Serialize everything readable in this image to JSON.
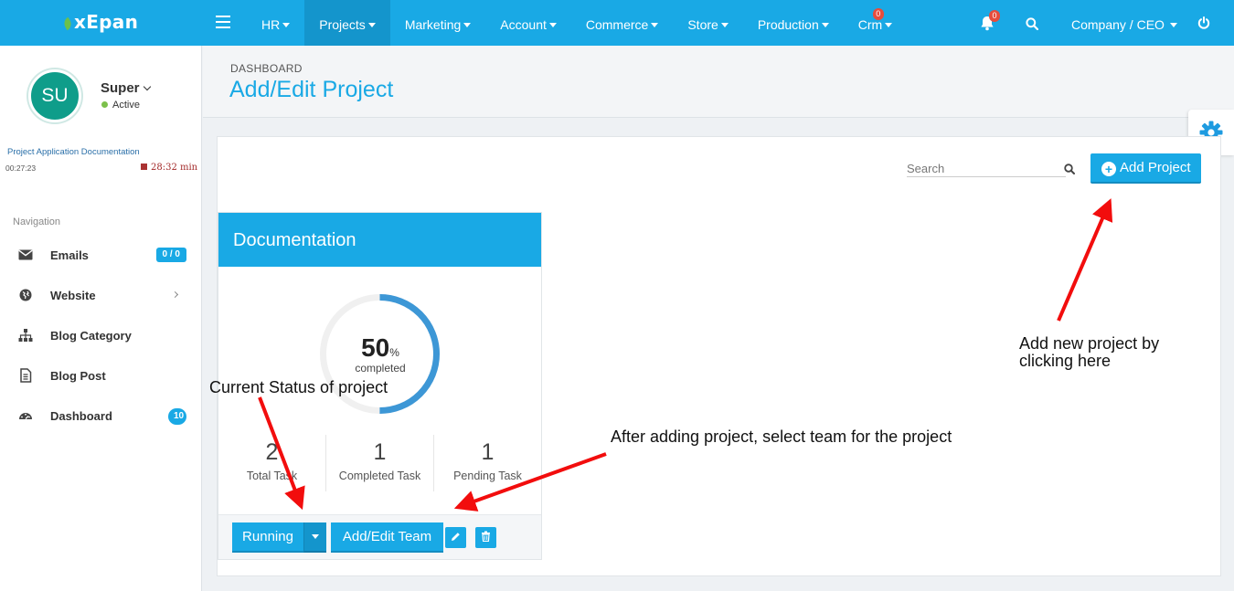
{
  "app": {
    "logo": "xEpan"
  },
  "topnav": {
    "items": [
      {
        "label": "HR"
      },
      {
        "label": "Projects",
        "active": true
      },
      {
        "label": "Marketing"
      },
      {
        "label": "Account"
      },
      {
        "label": "Commerce"
      },
      {
        "label": "Store"
      },
      {
        "label": "Production"
      },
      {
        "label": "Crm",
        "badge": "0"
      }
    ],
    "notification_badge": "0",
    "company": "Company / CEO"
  },
  "user": {
    "initials": "SU",
    "name": "Super",
    "status": "Active"
  },
  "timer": {
    "title": "Project Application Documentation",
    "elapsed": "00:27:23",
    "total": "28:32 min"
  },
  "sidebar": {
    "heading": "Navigation",
    "items": [
      {
        "label": "Emails",
        "icon": "envelope-icon",
        "count": "0 / 0"
      },
      {
        "label": "Website",
        "icon": "globe-icon"
      },
      {
        "label": "Blog Category",
        "icon": "sitemap-icon"
      },
      {
        "label": "Blog Post",
        "icon": "file-text-icon"
      },
      {
        "label": "Dashboard",
        "icon": "dashboard-icon",
        "count": "10"
      }
    ]
  },
  "page": {
    "breadcrumb": "DASHBOARD",
    "title": "Add/Edit Project"
  },
  "toolbar": {
    "search_placeholder": "Search",
    "add_label": "Add Project"
  },
  "project": {
    "name": "Documentation",
    "progress_value": "50",
    "progress_fraction": 0.5,
    "progress_unit": "%",
    "progress_caption": "completed",
    "stats": [
      {
        "value": "2",
        "label": "Total Task"
      },
      {
        "value": "1",
        "label": "Completed Task"
      },
      {
        "value": "1",
        "label": "Pending Task"
      }
    ],
    "status_label": "Running",
    "team_label": "Add/Edit Team"
  },
  "annotations": {
    "status": "Current Status of project",
    "team": "After adding project, select team for the project",
    "add_line1": "Add new project by",
    "add_line2": "clicking here"
  },
  "colors": {
    "primary": "#19a9e5",
    "progress_ring": "#3d97d6",
    "annotation_arrow": "#f20d0d",
    "avatar": "#0f9d8a"
  }
}
